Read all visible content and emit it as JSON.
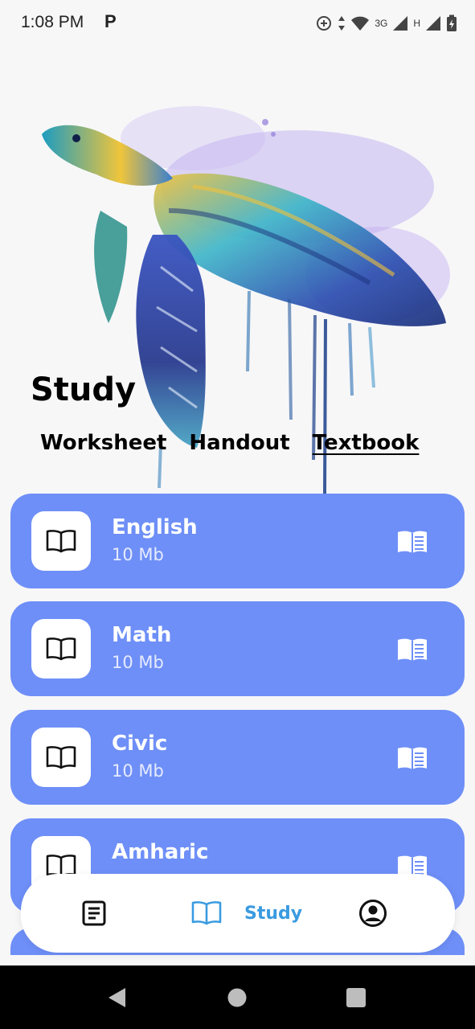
{
  "status_bar": {
    "time": "1:08 PM",
    "app_indicator": "P",
    "network_3g": "3G",
    "network_h": "H",
    "icons": [
      "data-saver-icon",
      "data-arrows-icon",
      "wifi-icon",
      "signal-icon",
      "battery-icon"
    ]
  },
  "hero": {
    "image": "watercolor-sea-turtle"
  },
  "page": {
    "title": "Study"
  },
  "tabs": [
    {
      "label": "Worksheet",
      "active": false
    },
    {
      "label": "Handout",
      "active": false
    },
    {
      "label": "Textbook",
      "active": true
    }
  ],
  "subjects": [
    {
      "title": "English",
      "size": "10 Mb"
    },
    {
      "title": "Math",
      "size": "10 Mb"
    },
    {
      "title": "Civic",
      "size": "10 Mb"
    },
    {
      "title": "Amharic",
      "size": ""
    }
  ],
  "bottom_nav": {
    "items": [
      {
        "icon": "document-list-icon",
        "label": ""
      },
      {
        "icon": "open-book-icon",
        "label": "Study",
        "active": true
      },
      {
        "icon": "profile-icon",
        "label": ""
      }
    ]
  },
  "colors": {
    "card": "#6e8ff7",
    "accent": "#3a9be0",
    "background": "#f7f7f8"
  }
}
